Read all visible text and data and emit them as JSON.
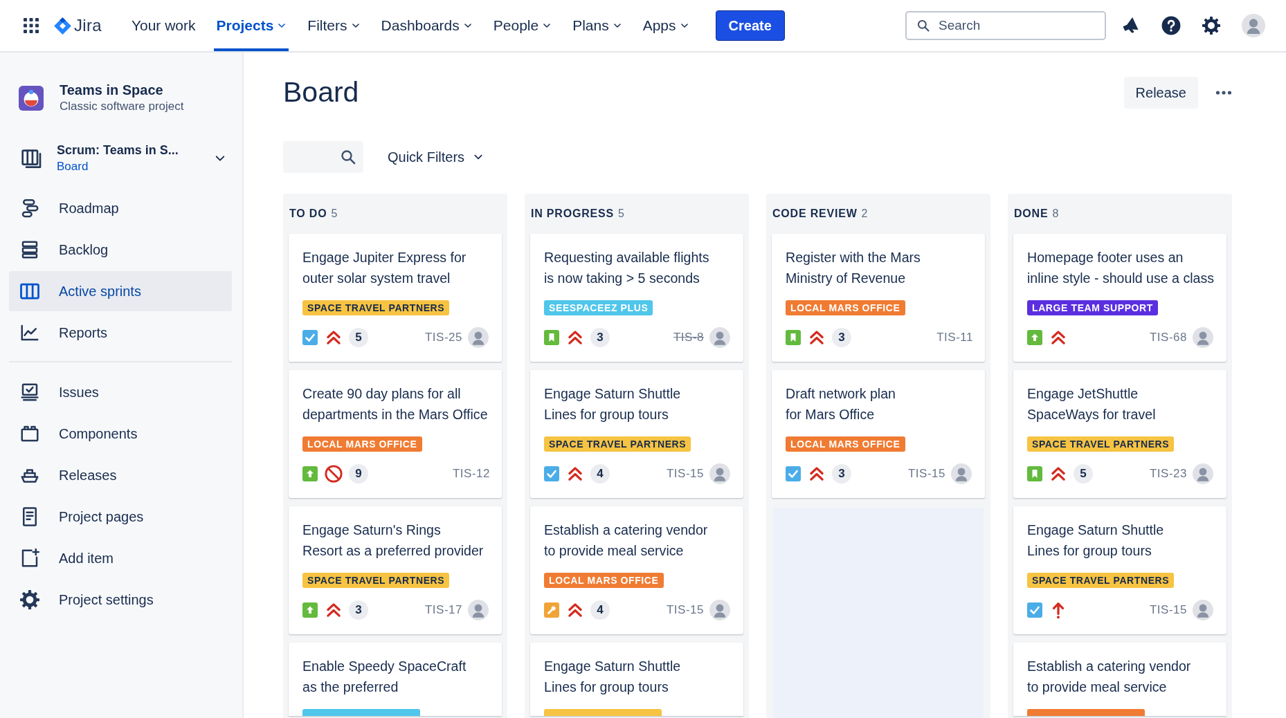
{
  "top_nav": {
    "product": "Jira",
    "items": [
      {
        "label": "Your work",
        "selected": false,
        "menu": false
      },
      {
        "label": "Projects",
        "selected": true,
        "menu": true
      },
      {
        "label": "Filters",
        "selected": false,
        "menu": true
      },
      {
        "label": "Dashboards",
        "selected": false,
        "menu": true
      },
      {
        "label": "People",
        "selected": false,
        "menu": true
      },
      {
        "label": "Plans",
        "selected": false,
        "menu": true
      },
      {
        "label": "Apps",
        "selected": false,
        "menu": true
      }
    ],
    "create_button": "Create",
    "search": {
      "placeholder": "Search"
    }
  },
  "sidebar": {
    "project": {
      "name": "Teams in Space",
      "type": "Classic software project"
    },
    "board_switcher": {
      "name": "Scrum: Teams in S...",
      "view": "Board"
    },
    "sections": [
      {
        "items": [
          {
            "label": "Roadmap",
            "selected": false
          },
          {
            "label": "Backlog",
            "selected": false
          },
          {
            "label": "Active sprints",
            "selected": true
          },
          {
            "label": "Reports",
            "selected": false
          }
        ]
      },
      {
        "items": [
          {
            "label": "Issues",
            "selected": false
          },
          {
            "label": "Components",
            "selected": false
          },
          {
            "label": "Releases",
            "selected": false
          },
          {
            "label": "Project pages",
            "selected": false
          },
          {
            "label": "Add item",
            "selected": false
          },
          {
            "label": "Project settings",
            "selected": false
          }
        ]
      }
    ]
  },
  "page": {
    "title": "Board",
    "release_button": "Release",
    "quick_filters": "Quick Filters"
  },
  "columns": [
    {
      "title": "TO DO",
      "count": "5",
      "cards": [
        {
          "title": "Engage Jupiter Express for outer solar system travel",
          "label": {
            "text": "SPACE TRAVEL PARTNERS",
            "color": "#f6c342"
          },
          "kind": "task",
          "priority": {
            "kind": "highest"
          },
          "estimate": "5",
          "key": "TIS-25",
          "resolved": false,
          "assigned": true
        },
        {
          "title": "Create 90 day plans for all departments in the Mars Office",
          "label": {
            "text": "LOCAL MARS OFFICE",
            "color": "#f07b32"
          },
          "kind": "improvement",
          "priority": {
            "kind": "blocker"
          },
          "estimate": "9",
          "key": "TIS-12",
          "resolved": false,
          "assigned": false
        },
        {
          "title": "Engage Saturn's Rings Resort as a preferred provider",
          "label": {
            "text": "SPACE TRAVEL PARTNERS",
            "color": "#f6c342"
          },
          "kind": "improvement",
          "priority": {
            "kind": "highest"
          },
          "estimate": "3",
          "key": "TIS-17",
          "resolved": false,
          "assigned": true
        },
        {
          "title": "Enable Speedy SpaceCraft as the preferred",
          "label": {
            "color": "#4fc6ea"
          }
        }
      ]
    },
    {
      "title": "IN PROGRESS",
      "count": "5",
      "cards": [
        {
          "title": "Requesting available flights is now taking > 5 seconds",
          "label": {
            "text": "SEESPACEEZ PLUS",
            "color": "#4fc6ea"
          },
          "kind": "story",
          "priority": {
            "kind": "highest"
          },
          "estimate": "3",
          "key": "TIS-8",
          "resolved": true,
          "assigned": true
        },
        {
          "title": "Engage Saturn Shuttle Lines for group tours",
          "label": {
            "text": "SPACE TRAVEL PARTNERS",
            "color": "#f6c342"
          },
          "kind": "task",
          "priority": {
            "kind": "highest"
          },
          "estimate": "4",
          "key": "TIS-15",
          "resolved": false,
          "assigned": true
        },
        {
          "title": "Establish a catering vendor to provide meal service",
          "label": {
            "text": "LOCAL MARS OFFICE",
            "color": "#f07b32"
          },
          "kind": "maintenance",
          "priority": {
            "kind": "highest"
          },
          "estimate": "4",
          "key": "TIS-15",
          "resolved": false,
          "assigned": true
        },
        {
          "title": "Engage Saturn Shuttle Lines for group tours",
          "label": {
            "color": "#f6c342"
          }
        }
      ]
    },
    {
      "title": "CODE REVIEW",
      "count": "2",
      "cards": [
        {
          "title": "Register with the Mars Ministry of Revenue",
          "label": {
            "text": "LOCAL MARS OFFICE",
            "color": "#f07b32"
          },
          "kind": "story",
          "priority": {
            "kind": "highest"
          },
          "estimate": "3",
          "key": "TIS-11",
          "resolved": false,
          "assigned": false
        },
        {
          "title": "Draft network plan for Mars Office",
          "label": {
            "text": "LOCAL MARS OFFICE",
            "color": "#f07b32"
          },
          "kind": "task",
          "priority": {
            "kind": "highest"
          },
          "estimate": "3",
          "key": "TIS-15",
          "resolved": false,
          "assigned": true
        }
      ]
    },
    {
      "title": "DONE",
      "count": "8",
      "cards": [
        {
          "title": "Homepage footer uses an inline style - should use a class",
          "label": {
            "text": "LARGE TEAM SUPPORT",
            "color": "#5b2fe0"
          },
          "kind": "improvement",
          "priority": {
            "kind": "highest"
          },
          "key": "TIS-68",
          "resolved": false,
          "assigned": true
        },
        {
          "title": "Engage JetShuttle SpaceWays for travel",
          "label": {
            "text": "SPACE TRAVEL PARTNERS",
            "color": "#f6c342"
          },
          "kind": "story",
          "priority": {
            "kind": "highest"
          },
          "estimate": "5",
          "key": "TIS-23",
          "resolved": false,
          "assigned": true
        },
        {
          "title": "Engage Saturn Shuttle Lines for group tours",
          "label": {
            "text": "SPACE TRAVEL PARTNERS",
            "color": "#f6c342"
          },
          "kind": "task",
          "priority": {
            "kind": "high"
          },
          "key": "TIS-15",
          "resolved": false,
          "assigned": true
        },
        {
          "title": "Establish a catering vendor to provide meal service",
          "label": {
            "color": "#f07b32"
          }
        }
      ]
    }
  ]
}
